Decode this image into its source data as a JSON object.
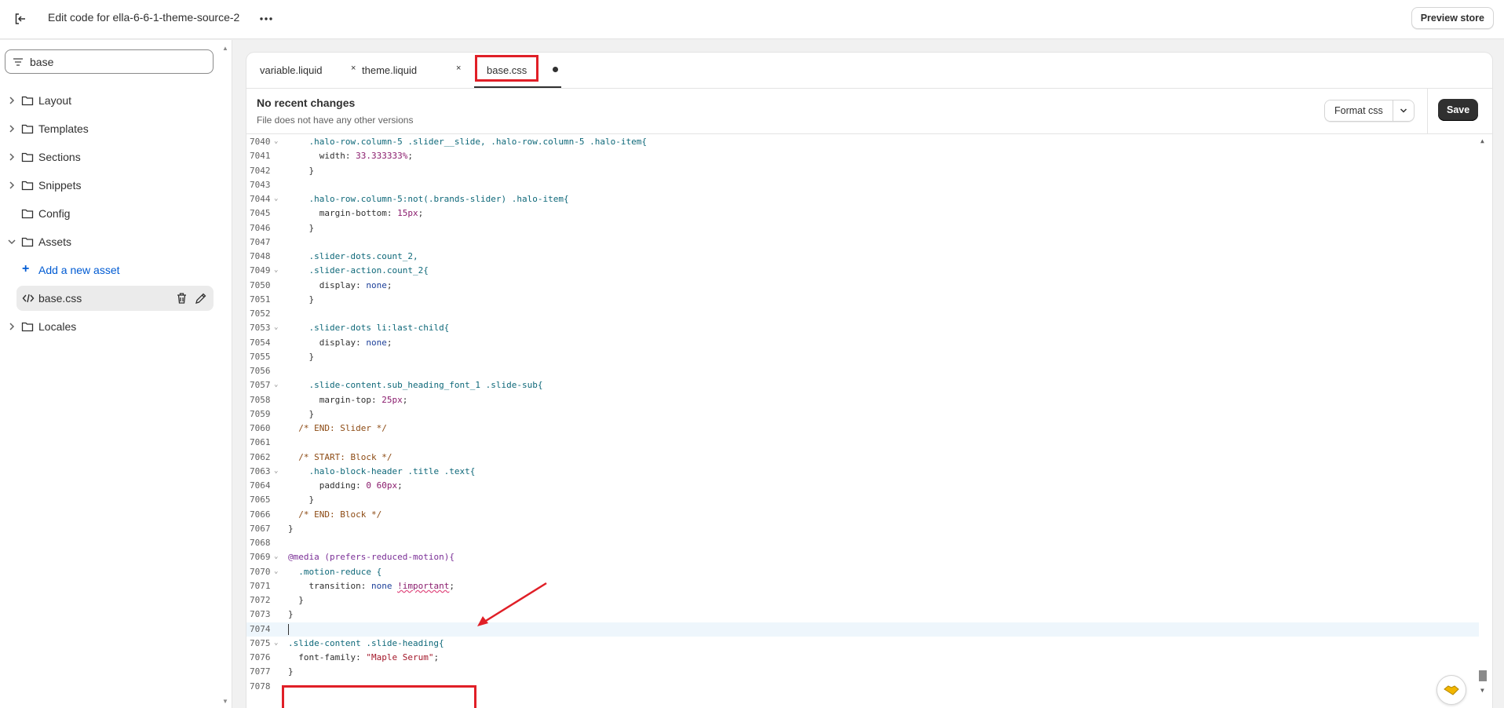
{
  "topbar": {
    "title": "Edit code for ella-6-6-1-theme-source-2",
    "preview_label": "Preview store"
  },
  "sidebar": {
    "search_value": "base",
    "items": [
      {
        "label": "Layout"
      },
      {
        "label": "Templates"
      },
      {
        "label": "Sections"
      },
      {
        "label": "Snippets"
      },
      {
        "label": "Config"
      },
      {
        "label": "Assets"
      }
    ],
    "add_asset_label": "Add a new asset",
    "active_file": "base.css",
    "locales_label": "Locales"
  },
  "tabs": [
    {
      "label": "variable.liquid",
      "close": "×"
    },
    {
      "label": "theme.liquid",
      "close": "×"
    },
    {
      "label": "base.css"
    }
  ],
  "info": {
    "title": "No recent changes",
    "subtitle": "File does not have any other versions",
    "format_label": "Format css",
    "save_label": "Save"
  },
  "code_lines": [
    {
      "n": "7040",
      "fold": true
    },
    {
      "n": "7041"
    },
    {
      "n": "7042"
    },
    {
      "n": "7043"
    },
    {
      "n": "7044",
      "fold": true
    },
    {
      "n": "7045"
    },
    {
      "n": "7046"
    },
    {
      "n": "7047"
    },
    {
      "n": "7048"
    },
    {
      "n": "7049",
      "fold": true
    },
    {
      "n": "7050"
    },
    {
      "n": "7051"
    },
    {
      "n": "7052"
    },
    {
      "n": "7053",
      "fold": true
    },
    {
      "n": "7054"
    },
    {
      "n": "7055"
    },
    {
      "n": "7056"
    },
    {
      "n": "7057",
      "fold": true
    },
    {
      "n": "7058"
    },
    {
      "n": "7059"
    },
    {
      "n": "7060"
    },
    {
      "n": "7061"
    },
    {
      "n": "7062"
    },
    {
      "n": "7063",
      "fold": true
    },
    {
      "n": "7064"
    },
    {
      "n": "7065"
    },
    {
      "n": "7066"
    },
    {
      "n": "7067"
    },
    {
      "n": "7068"
    },
    {
      "n": "7069",
      "fold": true
    },
    {
      "n": "7070",
      "fold": true
    },
    {
      "n": "7071"
    },
    {
      "n": "7072"
    },
    {
      "n": "7073"
    },
    {
      "n": "7074"
    },
    {
      "n": "7075",
      "fold": true
    },
    {
      "n": "7076"
    },
    {
      "n": "7077"
    },
    {
      "n": "7078"
    }
  ],
  "code": {
    "l7040": ".halo-row.column-5 .slider__slide, .halo-row.column-5 .halo-item{",
    "l7041_prop": "width: ",
    "l7041_val": "33.333333%",
    "l7044": ".halo-row.column-5:not(.brands-slider) .halo-item{",
    "l7045_prop": "margin-bottom: ",
    "l7045_val": "15px",
    "l7048": ".slider-dots.count_2,",
    "l7049": ".slider-action.count_2{",
    "l7050_prop": "display: ",
    "l7050_val": "none",
    "l7053": ".slider-dots li:last-child{",
    "l7054_prop": "display: ",
    "l7054_val": "none",
    "l7057": ".slide-content.sub_heading_font_1 .slide-sub{",
    "l7058_prop": "margin-top: ",
    "l7058_val": "25px",
    "l7060": "/* END: Slider */",
    "l7062": "/* START: Block */",
    "l7063": ".halo-block-header .title .text{",
    "l7064_prop": "padding: ",
    "l7064_val": "0 60px",
    "l7066": "/* END: Block */",
    "l7069_at": "@media",
    "l7069_rest": " (prefers-reduced-motion){",
    "l7070": ".motion-reduce {",
    "l7071_prop": "transition: ",
    "l7071_val": "none",
    "l7071_imp": "!important",
    "l7075": ".slide-content .slide-heading{",
    "l7076_prop": "font-family: ",
    "l7076_val": "\"Maple Serum\"",
    "brace_close": "}",
    "semi": ";"
  },
  "colors": {
    "accent_link": "#005bd3",
    "annotation_red": "#e01f27",
    "save_bg": "#303030"
  }
}
